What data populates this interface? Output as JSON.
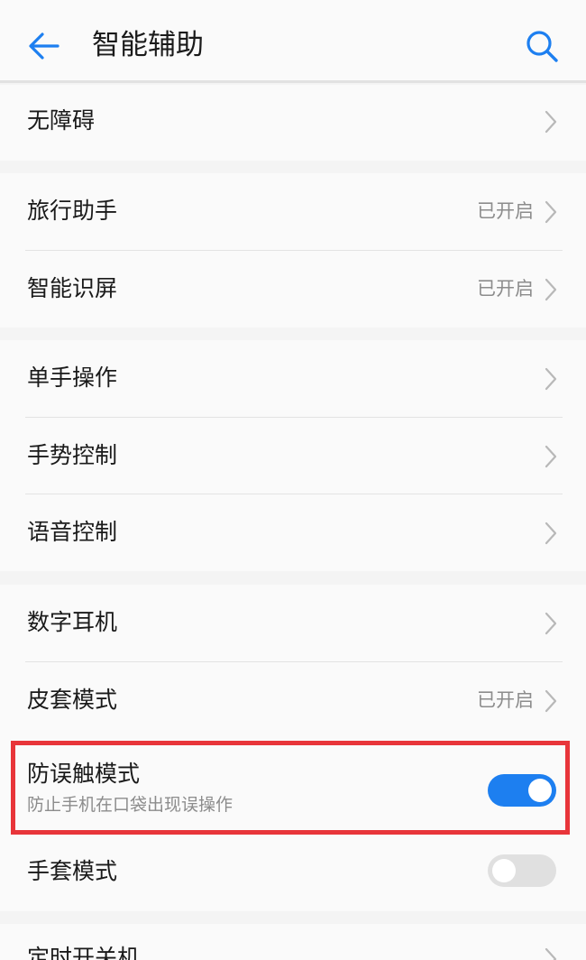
{
  "header": {
    "title": "智能辅助",
    "back_icon": "back-arrow-icon",
    "search_icon": "search-icon"
  },
  "groups": [
    {
      "items": [
        {
          "label": "无障碍",
          "status": ""
        }
      ]
    },
    {
      "items": [
        {
          "label": "旅行助手",
          "status": "已开启"
        },
        {
          "label": "智能识屏",
          "status": "已开启"
        }
      ]
    },
    {
      "items": [
        {
          "label": "单手操作",
          "status": ""
        },
        {
          "label": "手势控制",
          "status": ""
        },
        {
          "label": "语音控制",
          "status": ""
        }
      ]
    },
    {
      "items": [
        {
          "label": "数字耳机",
          "status": ""
        },
        {
          "label": "皮套模式",
          "status": "已开启"
        },
        {
          "label": "防误触模式",
          "subtitle": "防止手机在口袋出现误操作",
          "toggle": true
        },
        {
          "label": "手套模式",
          "toggle": false
        }
      ]
    },
    {
      "items": [
        {
          "label": "定时开关机",
          "status": ""
        }
      ]
    }
  ],
  "colors": {
    "accent": "#1d7ff0",
    "highlight": "#e8353a",
    "toggle_off": "#e0e0e0",
    "secondary_text": "#8c8c8c",
    "background": "#f4f4f4"
  }
}
